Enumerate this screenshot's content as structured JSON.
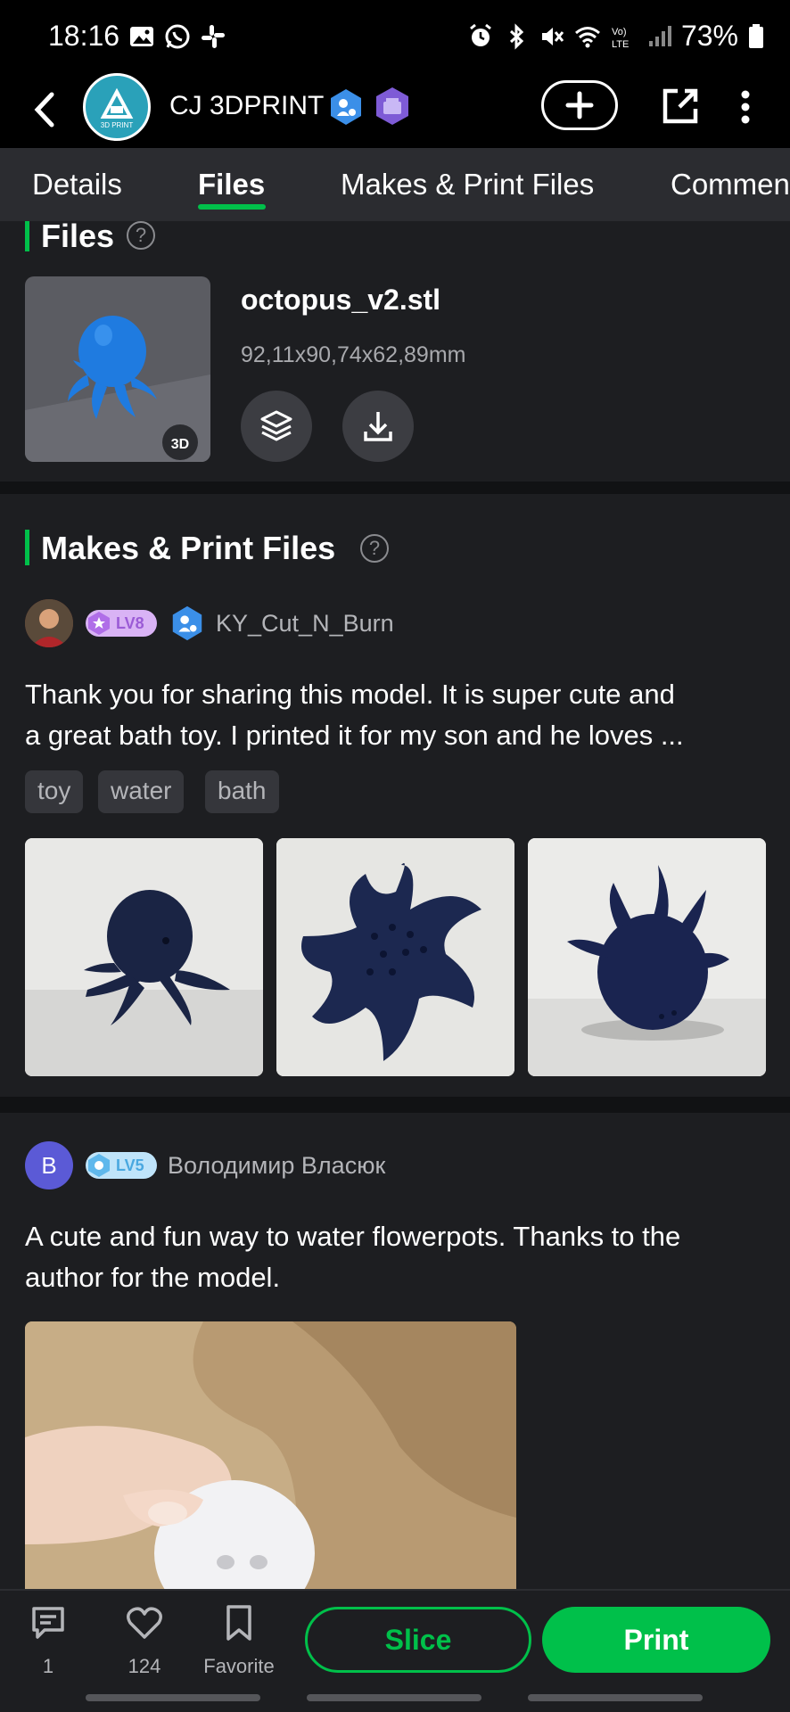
{
  "status_bar": {
    "time": "18:16",
    "battery": "73%",
    "left_icons": [
      "gallery-icon",
      "whatsapp-icon",
      "slack-icon"
    ],
    "right_icons": [
      "alarm-icon",
      "bluetooth-icon",
      "mute-icon",
      "wifi-icon",
      "volte-icon",
      "signal-icon",
      "battery-icon"
    ]
  },
  "header": {
    "channel_name": "CJ 3DPRINT",
    "logo_text": "3D PRINT"
  },
  "tabs": [
    {
      "label": "Details",
      "active": false
    },
    {
      "label": "Files",
      "active": true
    },
    {
      "label": "Makes & Print Files",
      "active": false
    },
    {
      "label": "Commen",
      "active": false
    }
  ],
  "files_section": {
    "title": "Files",
    "help": "?",
    "file": {
      "name": "octopus_v2.stl",
      "dimensions": "92,11x90,74x62,89mm",
      "badge_3d": "3D"
    }
  },
  "makes_section": {
    "title": "Makes & Print Files",
    "help": "?",
    "posts": [
      {
        "level": "LV8",
        "username": "KY_Cut_N_Burn",
        "text_line1": "Thank you for sharing this model.  It is super cute and",
        "text_line2": "a great bath toy.  I printed it for my son and he loves ...",
        "tags": [
          "toy",
          "water",
          "bath"
        ]
      },
      {
        "avatar_letter": "B",
        "level": "LV5",
        "username": "Володимир Власюк",
        "text_line1": "A cute and fun way to water flowerpots. Thanks to the",
        "text_line2": "author for the model."
      }
    ]
  },
  "bottom_bar": {
    "comments_count": "1",
    "likes_count": "124",
    "favorite_label": "Favorite",
    "slice_label": "Slice",
    "print_label": "Print"
  },
  "colors": {
    "accent": "#00c04a",
    "background": "#1d1e21",
    "header": "#000000",
    "tabs": "#2b2c30"
  }
}
